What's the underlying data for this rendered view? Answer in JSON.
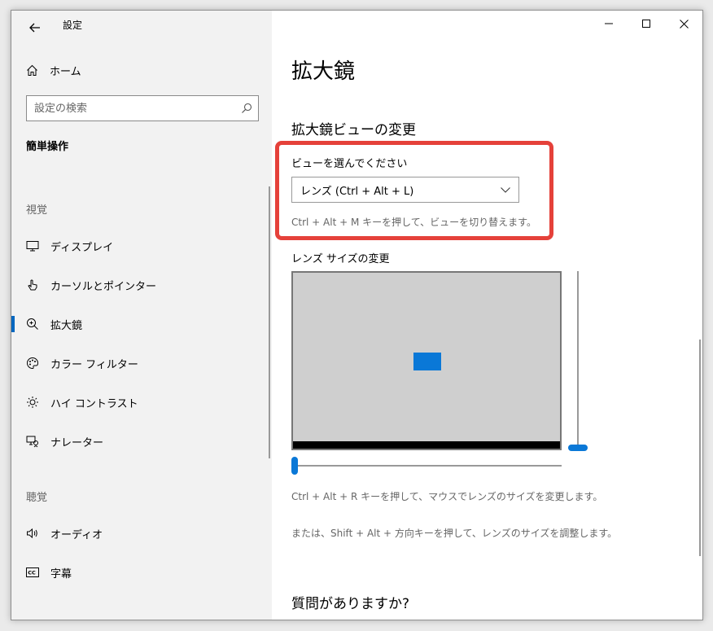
{
  "window": {
    "title": "設定"
  },
  "sidebar": {
    "home_label": "ホーム",
    "search_placeholder": "設定の検索",
    "category": "簡単操作",
    "sections": [
      {
        "label": "視覚",
        "items": [
          {
            "label": "ディスプレイ",
            "icon": "monitor-icon"
          },
          {
            "label": "カーソルとポインター",
            "icon": "pointer-icon"
          },
          {
            "label": "拡大鏡",
            "icon": "magnifier-icon",
            "selected": true
          },
          {
            "label": "カラー フィルター",
            "icon": "palette-icon"
          },
          {
            "label": "ハイ コントラスト",
            "icon": "brightness-icon"
          },
          {
            "label": "ナレーター",
            "icon": "narrator-icon"
          }
        ]
      },
      {
        "label": "聴覚",
        "items": [
          {
            "label": "オーディオ",
            "icon": "speaker-icon"
          },
          {
            "label": "字幕",
            "icon": "caption-icon"
          }
        ]
      }
    ]
  },
  "content": {
    "title": "拡大鏡",
    "subhead": "拡大鏡ビューの変更",
    "view_label": "ビューを選んでください",
    "view_selected": "レンズ (Ctrl + Alt + L)",
    "view_hint": "Ctrl + Alt + M キーを押して、ビューを切り替えます。",
    "lens_size_head": "レンズ サイズの変更",
    "lens_hint1": "Ctrl + Alt + R キーを押して、マウスでレンズのサイズを変更します。",
    "lens_hint2": "または、Shift + Alt + 方向キーを押して、レンズのサイズを調整します。",
    "question": "質問がありますか?"
  },
  "colors": {
    "accent": "#0a78d7",
    "highlight": "#e5413a"
  }
}
